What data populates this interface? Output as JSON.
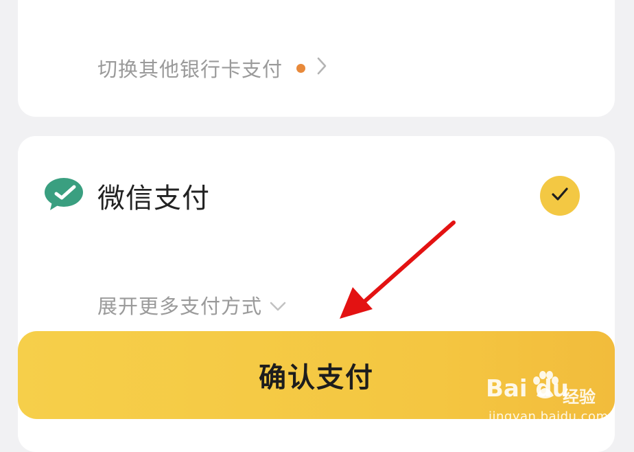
{
  "bank_switch": {
    "label": "切换其他银行卡支付"
  },
  "wechat_pay": {
    "label": "微信支付",
    "selected": true
  },
  "expand_more": {
    "label": "展开更多支付方式"
  },
  "confirm_button": {
    "label": "确认支付"
  },
  "watermark": {
    "logo": "Bai du",
    "cn": "经验",
    "url": "jingyan.baidu.com"
  },
  "colors": {
    "accent_yellow": "#f4c641",
    "wechat_green": "#3a9f80",
    "dot_orange": "#e8893a",
    "arrow_red": "#e31212"
  },
  "icons": [
    "chevron-right-icon",
    "wechat-logo-icon",
    "check-icon",
    "chevron-down-icon",
    "red-arrow-annotation"
  ]
}
